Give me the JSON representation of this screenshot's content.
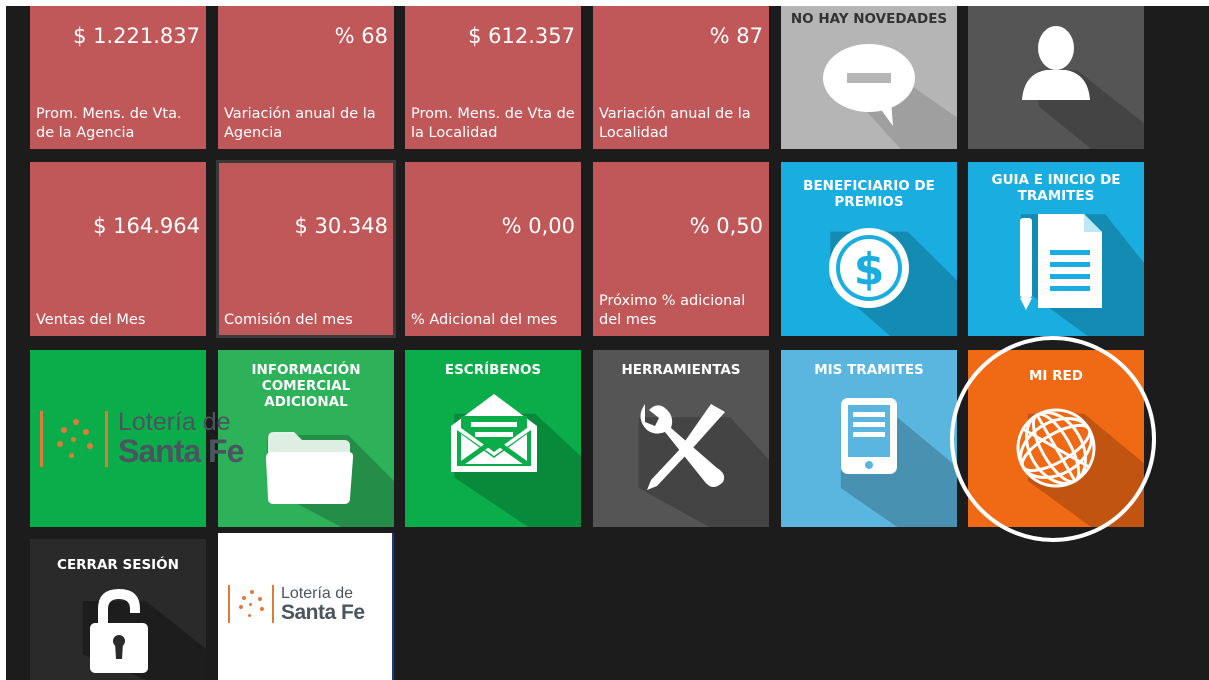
{
  "stats": [
    {
      "value": "$ 1.221.837",
      "label": "Prom. Mens. de Vta. de la Agencia"
    },
    {
      "value": "% 68",
      "label": "Variación anual de la Agencia"
    },
    {
      "value": "$ 612.357",
      "label": "Prom. Mens. de Vta de la Localidad"
    },
    {
      "value": "% 87",
      "label": "Variación anual de la Localidad"
    },
    {
      "value": "$ 164.964",
      "label": "Ventas del Mes"
    },
    {
      "value": "$ 30.348",
      "label": "Comisión del mes"
    },
    {
      "value": "% 0,00",
      "label": "% Adicional del mes"
    },
    {
      "value": "% 0,50",
      "label": "Próximo % adicional del mes"
    }
  ],
  "tiles": {
    "novedades": "NO HAY NOVEDADES",
    "beneficiario": "BENEFICIARIO DE PREMIOS",
    "guia": "GUIA E INICIO DE TRAMITES",
    "informacion": "INFORMACIÓN COMERCIAL ADICIONAL",
    "escribenos": "ESCRÍBENOS",
    "herramientas": "HERRAMIENTAS",
    "mis_tramites": "MIS TRAMITES",
    "mi_red": "MI RED",
    "cerrar_sesion": "CERRAR SESIÓN"
  },
  "logo": {
    "line1": "Lotería de",
    "line2": "Santa Fe"
  },
  "colors": {
    "stat": "#c0585a",
    "green": "#0aad4a",
    "light_blue": "#1aaee0",
    "sky": "#5ab6de",
    "orange": "#f06914",
    "gray": "#555555",
    "light_gray": "#b5b5b5",
    "dark": "#2a2a2a"
  }
}
